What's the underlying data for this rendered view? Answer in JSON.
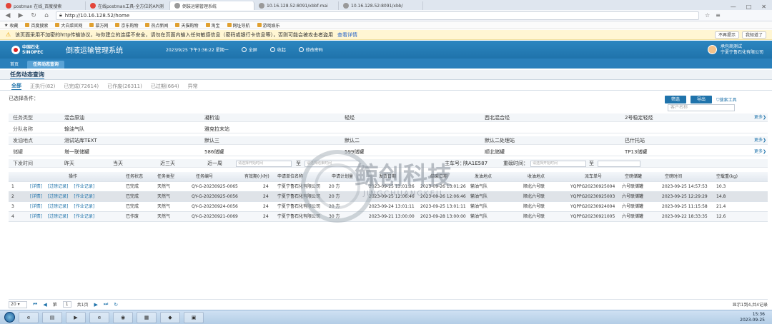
{
  "browser": {
    "tabs": [
      {
        "label": "postman 在线_百度搜索",
        "active": false
      },
      {
        "label": "在线postman工具-全方位的API测",
        "active": false
      },
      {
        "label": "倒装运输管理系统",
        "active": true
      },
      {
        "label": "10.16.128.52:8091/xbbf-mai",
        "active": false
      },
      {
        "label": "10.16.128.52:8091/xbb/",
        "active": false
      }
    ],
    "url": "http://10.16.128.52/home",
    "bookmarks": [
      "收藏",
      "百度搜索",
      "大白菜官网",
      "慕万网",
      "京东购物",
      "热点新闻",
      "天猫购物",
      "淘宝",
      "网址导航",
      "游戏娱乐"
    ],
    "warning": "该页面采用不加密的http传输协议，与你建立的连接不安全，请勿在页面内输入任何敏感信息（密码或银行卡信息等），否则可能会被攻击者盗用",
    "warning_link": "查看详情",
    "warning_btn1": "不再提示",
    "warning_btn2": "我知道了"
  },
  "app": {
    "logo_line1": "中国石化",
    "logo_line2": "SINOPEC",
    "title": "倒液运输管理系统",
    "datetime": "2023/9/25 下午3:36:22 星期一",
    "btn_fullscreen": "全屏",
    "btn_favorite": "收起",
    "btn_password": "修改密码",
    "user_line1": "承包商测试",
    "user_line2": "宁夏宁鲁石化有限公司"
  },
  "nav": {
    "tabs": [
      "首页",
      "任务动态查询"
    ]
  },
  "page": {
    "title": "任务动态查询",
    "filter_tabs": [
      "全部",
      "正执行(82)",
      "已完成(72614)",
      "已作废(26311)",
      "已过期(664)",
      "异常"
    ],
    "selected_cond": "已选择条件：",
    "btn_filter": "筛选",
    "btn_export": "导出",
    "btn_search_tool": "搜索工具",
    "customer_placeholder": "客户名称",
    "more": "更多",
    "conditions": {
      "task_type": {
        "label": "任务类型",
        "values": [
          "混合原油",
          "凝析油",
          "轻烃",
          "西北混合烃",
          "2号稳定轻烃"
        ]
      },
      "team": {
        "label": "分队名称",
        "values": [
          "输油气队",
          "雅克拉末站"
        ]
      },
      "origin": {
        "label": "发油地点",
        "values": [
          "测试站库TEXT",
          "默认三",
          "默认二",
          "默认二处理站",
          "巴什托站"
        ]
      },
      "tank": {
        "label": "储罐",
        "values": [
          "塔一联储罐",
          "586储罐",
          "599储罐",
          "顺北储罐",
          "TP13储罐"
        ]
      },
      "issue_time": {
        "label": "下发时间",
        "values": [
          "昨天",
          "当天",
          "近三天",
          "近一周"
        ],
        "start_ph": "请选择开始时间",
        "to": "至",
        "end_ph": "请选择结束时间",
        "plate_label": "主车号：",
        "plate": "陕A1E587",
        "weigh_label": "重磅时间：",
        "weigh_ph": "请选择开始时间",
        "weigh_to": "至"
      }
    }
  },
  "grid": {
    "headers": [
      "操作",
      "任务状态",
      "任务类型",
      "任务编号",
      "有效期(小时)",
      "申请单位名称",
      "申请计划量",
      "发货日期",
      "结束日期",
      "发油地点",
      "收油地点",
      "派车单号",
      "空磅储罐",
      "空磅时间",
      "空载重(kg)"
    ],
    "rows": [
      {
        "no": "1",
        "ops": [
          "[详情]",
          "[过磅记录]",
          "[作业记录]"
        ],
        "status": "已完成",
        "type": "天然气",
        "task_no": "QY-G-20230925-0065",
        "valid": "24",
        "unit": "宁夏宁鲁石化有限公司",
        "plan": "20 方",
        "ship": "2023-09-25 13:01:26",
        "end": "2023-09-26 13:01:26",
        "origin": "输油气队",
        "dest": "顺北六号联",
        "dispatch": "YQPPG20230925004",
        "tank": "六号联储罐",
        "empty_time": "2023-09-25 14:57:53",
        "empty_wt": "10.3"
      },
      {
        "no": "2",
        "ops": [
          "[详情]",
          "[过磅记录]",
          "[作业记录]"
        ],
        "status": "已完成",
        "type": "天然气",
        "task_no": "QY-G-20230925-0056",
        "valid": "24",
        "unit": "宁夏宁鲁石化有限公司",
        "plan": "20 方",
        "ship": "2023-09-25 12:06:46",
        "end": "2023-09-26 12:06:46",
        "origin": "输油气队",
        "dest": "顺北六号联",
        "dispatch": "YQPPG20230925003",
        "tank": "六号联储罐",
        "empty_time": "2023-09-25 12:29:29",
        "empty_wt": "14.8"
      },
      {
        "no": "3",
        "ops": [
          "[详情]",
          "[过磅记录]",
          "[作业记录]"
        ],
        "status": "已完成",
        "type": "天然气",
        "task_no": "QY-G-20230924-0056",
        "valid": "24",
        "unit": "宁夏宁鲁石化有限公司",
        "plan": "20 方",
        "ship": "2023-09-24 13:01:11",
        "end": "2023-09-25 13:01:11",
        "origin": "输油气队",
        "dest": "顺北六号联",
        "dispatch": "YQPPG20230924004",
        "tank": "六号联储罐",
        "empty_time": "2023-09-25 11:15:58",
        "empty_wt": "21.4"
      },
      {
        "no": "4",
        "ops": [
          "[详情]",
          "[过磅记录]",
          "[作业记录]"
        ],
        "status": "已作废",
        "type": "天然气",
        "task_no": "QY-G-20230921-0069",
        "valid": "24",
        "unit": "宁夏宁鲁石化有限公司",
        "plan": "30 方",
        "ship": "2023-09-21 13:00:00",
        "end": "2023-09-28 13:00:00",
        "origin": "输油气队",
        "dest": "顺北六号联",
        "dispatch": "YQPPG20230921005",
        "tank": "六号联储罐",
        "empty_time": "2023-09-22 18:33:35",
        "empty_wt": "12.6"
      }
    ]
  },
  "pager": {
    "page_size": "20",
    "page_label": "第",
    "page": "1",
    "of": "共1页",
    "summary": "显示1到4,共4记录"
  },
  "watermark": {
    "cn": "鲸创科技",
    "en": "JINGCHUANGKEJI"
  },
  "taskbar": {
    "time": "15:36",
    "date": "2023-09-25"
  },
  "colors": {
    "header_blue": "#1f73ab",
    "nav_blue": "#2a80bb",
    "warning_bg": "#fff6d3",
    "highlight_row": "#dfe3e8"
  }
}
